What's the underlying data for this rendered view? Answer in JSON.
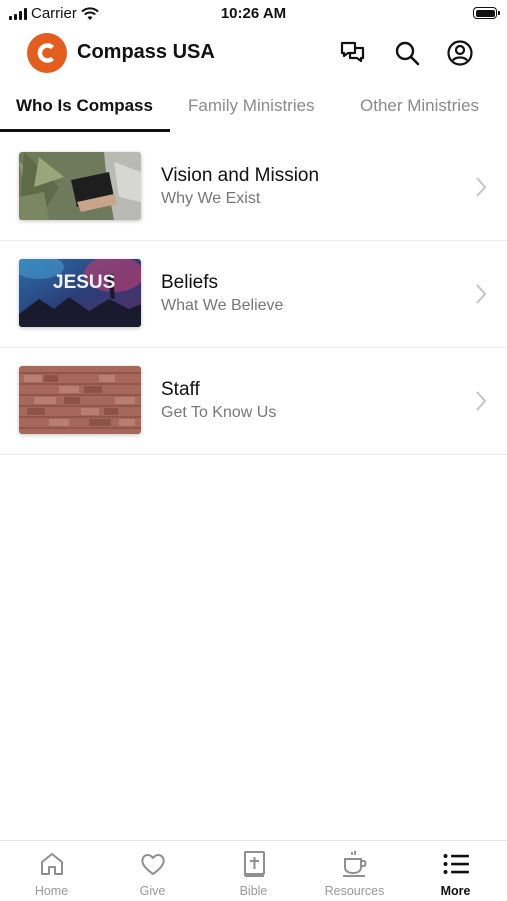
{
  "status_bar": {
    "carrier": "Carrier",
    "time": "10:26 AM"
  },
  "header": {
    "title": "Compass USA",
    "logo_letter": "C",
    "brand_color": "#e25d1e"
  },
  "tabs": [
    {
      "label": "Who Is Compass",
      "active": true
    },
    {
      "label": "Family Ministries",
      "active": false
    },
    {
      "label": "Other Ministries",
      "active": false
    }
  ],
  "list": [
    {
      "title": "Vision and Mission",
      "subtitle": "Why We Exist"
    },
    {
      "title": "Beliefs",
      "subtitle": "What We Believe",
      "thumb_text": "JESUS"
    },
    {
      "title": "Staff",
      "subtitle": "Get To Know Us"
    }
  ],
  "bottom_nav": [
    {
      "label": "Home",
      "icon": "home-icon",
      "active": false
    },
    {
      "label": "Give",
      "icon": "heart-icon",
      "active": false
    },
    {
      "label": "Bible",
      "icon": "bible-icon",
      "active": false
    },
    {
      "label": "Resources",
      "icon": "coffee-cup-icon",
      "active": false
    },
    {
      "label": "More",
      "icon": "list-icon",
      "active": true
    }
  ]
}
